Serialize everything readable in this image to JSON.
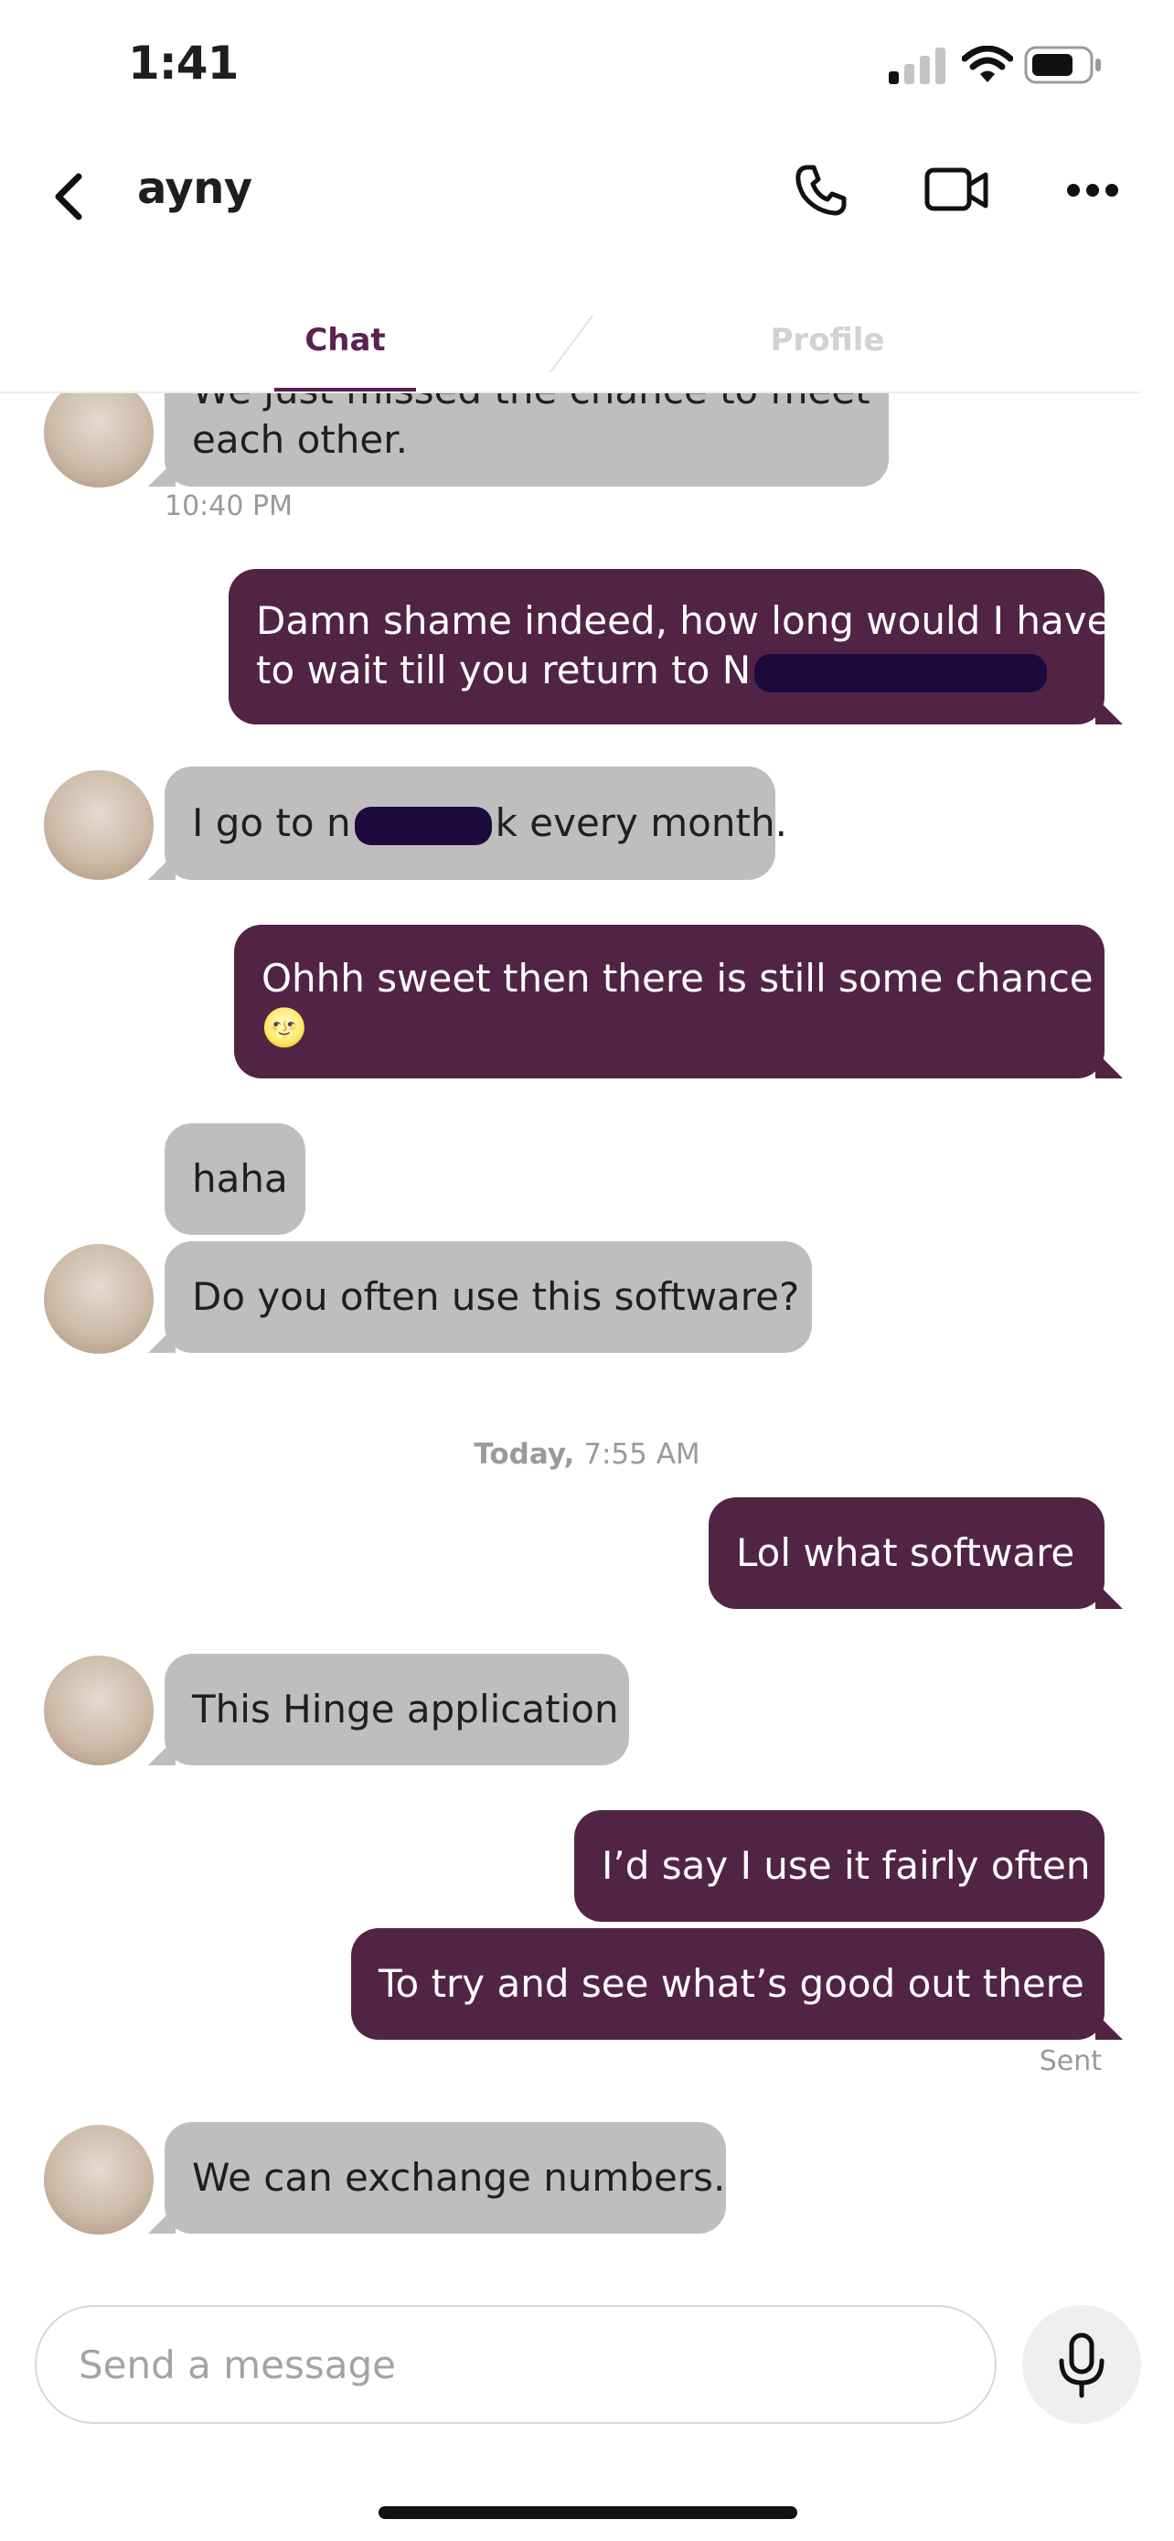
{
  "status_bar": {
    "time": "1:41"
  },
  "header": {
    "name": "ayny"
  },
  "tabs": [
    {
      "label": "Chat"
    },
    {
      "label": "Profile"
    }
  ],
  "messages": [
    {
      "from": "them",
      "text_line1": "We just missed the chance to meet",
      "text_line2": "each other.",
      "time": "10:40 PM"
    },
    {
      "from": "me",
      "text_line1": "Damn shame indeed, how long would I have",
      "text_line2": "to wait till you return to N"
    },
    {
      "from": "them",
      "text_before": "I go to n",
      "text_after": "k every month."
    },
    {
      "from": "me",
      "text_line1": "Ohhh sweet then there is still some chance",
      "emoji": "🌝"
    },
    {
      "from": "them",
      "text": "haha"
    },
    {
      "from": "them",
      "text": "Do you often use this software?"
    },
    {
      "from": "me",
      "text": "Lol what software"
    },
    {
      "from": "them",
      "text": "This Hinge application"
    },
    {
      "from": "me",
      "text": "I’d say I use it fairly often"
    },
    {
      "from": "me",
      "text": "To try and see what’s good out there",
      "status": "Sent"
    },
    {
      "from": "them",
      "text": "We can exchange numbers."
    }
  ],
  "date_separator": {
    "day": "Today,",
    "time": "7:55 AM"
  },
  "composer": {
    "placeholder": "Send a message"
  },
  "icons": {
    "back": "chevron-left-icon",
    "call": "phone-icon",
    "video": "video-camera-icon",
    "more": "more-dots-icon",
    "mic": "microphone-icon",
    "signal": "cellular-signal-icon",
    "wifi": "wifi-icon",
    "battery": "battery-icon"
  },
  "colors": {
    "accent": "#512445",
    "incoming_bubble": "#bebebe",
    "tab_active": "#5b2150"
  }
}
